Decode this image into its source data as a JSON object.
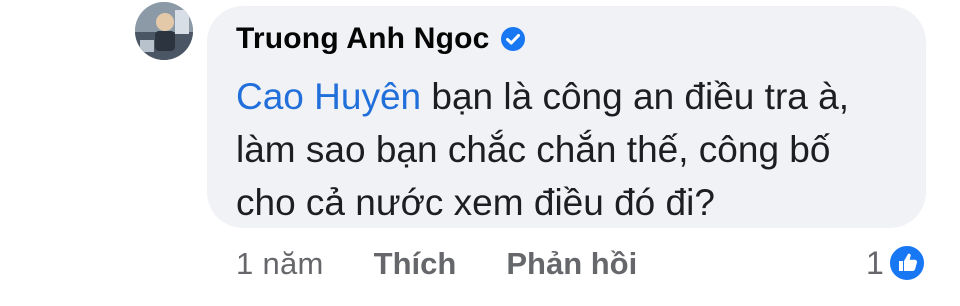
{
  "comment": {
    "author": "Truong Anh Ngoc",
    "verified": true,
    "mention": "Cao Huyên",
    "text_line1_rest": " bạn là công an điều tra à,",
    "text_line2": "làm sao bạn chắc chắn thế, công bố",
    "text_line3": "cho cả nước xem điều đó đi?",
    "time": "1 năm",
    "like_label": "Thích",
    "reply_label": "Phản hồi",
    "reaction_count": "1"
  },
  "colors": {
    "bubble_bg": "#f0f2f5",
    "mention": "#216fdb",
    "verified_badge": "#1877f2",
    "meta_text": "#65676b"
  },
  "icons": {
    "verified": "verified-badge-icon",
    "reaction": "thumbs-up-icon"
  }
}
